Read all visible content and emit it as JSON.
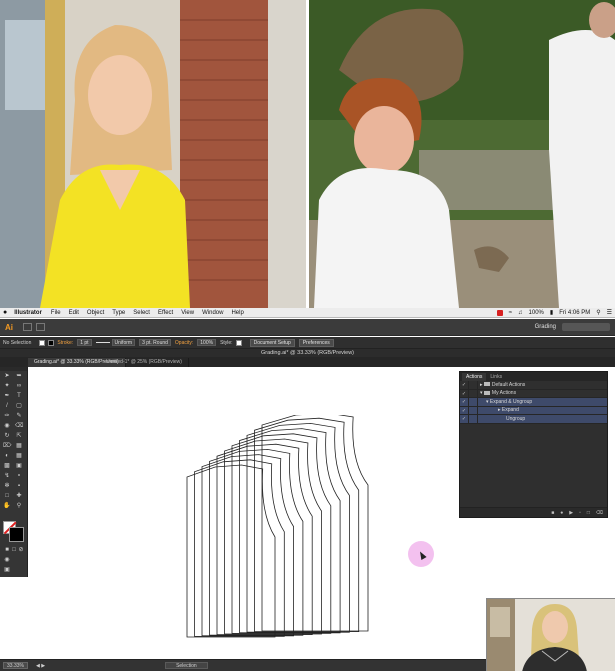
{
  "photos": {
    "left": "portrait-woman-yellow-shirt",
    "right": "monkey-on-head-photo"
  },
  "menubar": {
    "app": "Illustrator",
    "items": [
      "File",
      "Edit",
      "Object",
      "Type",
      "Select",
      "Effect",
      "View",
      "Window",
      "Help"
    ],
    "battery": "100%",
    "clock": "Fri 4:06 PM"
  },
  "appbar": {
    "logo": "Ai",
    "workspace": "Grading"
  },
  "control": {
    "selection": "No Selection",
    "stroke_label": "Stroke:",
    "stroke_value": "1 pt",
    "uniform": "Uniform",
    "brush": "3 pt. Round",
    "opacity_label": "Opacity:",
    "opacity_value": "100%",
    "style_label": "Style:",
    "doc_setup": "Document Setup",
    "preferences": "Preferences"
  },
  "document": {
    "window_title": "Grading.ai* @ 33.33% (RGB/Preview)",
    "tab_active": "Grading.ai* @ 33.33% (RGB/Preview)",
    "tab_other": "Untitled-1* @ 25% (RGB/Preview)"
  },
  "actions_panel": {
    "tabs": [
      "Actions",
      "Links"
    ],
    "rows": [
      {
        "label": "Default Actions",
        "level": 0,
        "selected": false
      },
      {
        "label": "My Actions",
        "level": 0,
        "selected": false
      },
      {
        "label": "Expand & Ungroup",
        "level": 1,
        "selected": true
      },
      {
        "label": "Expand",
        "level": 2,
        "selected": true
      },
      {
        "label": "Ungroup",
        "level": 2,
        "selected": true
      }
    ]
  },
  "status": {
    "zoom": "33.33%",
    "tool": "Selection"
  },
  "colors": {
    "ui_dark": "#353535",
    "accent_orange": "#f49a22",
    "cursor_highlight": "#f1b6ec",
    "selection_blue": "#3e4a6a"
  }
}
